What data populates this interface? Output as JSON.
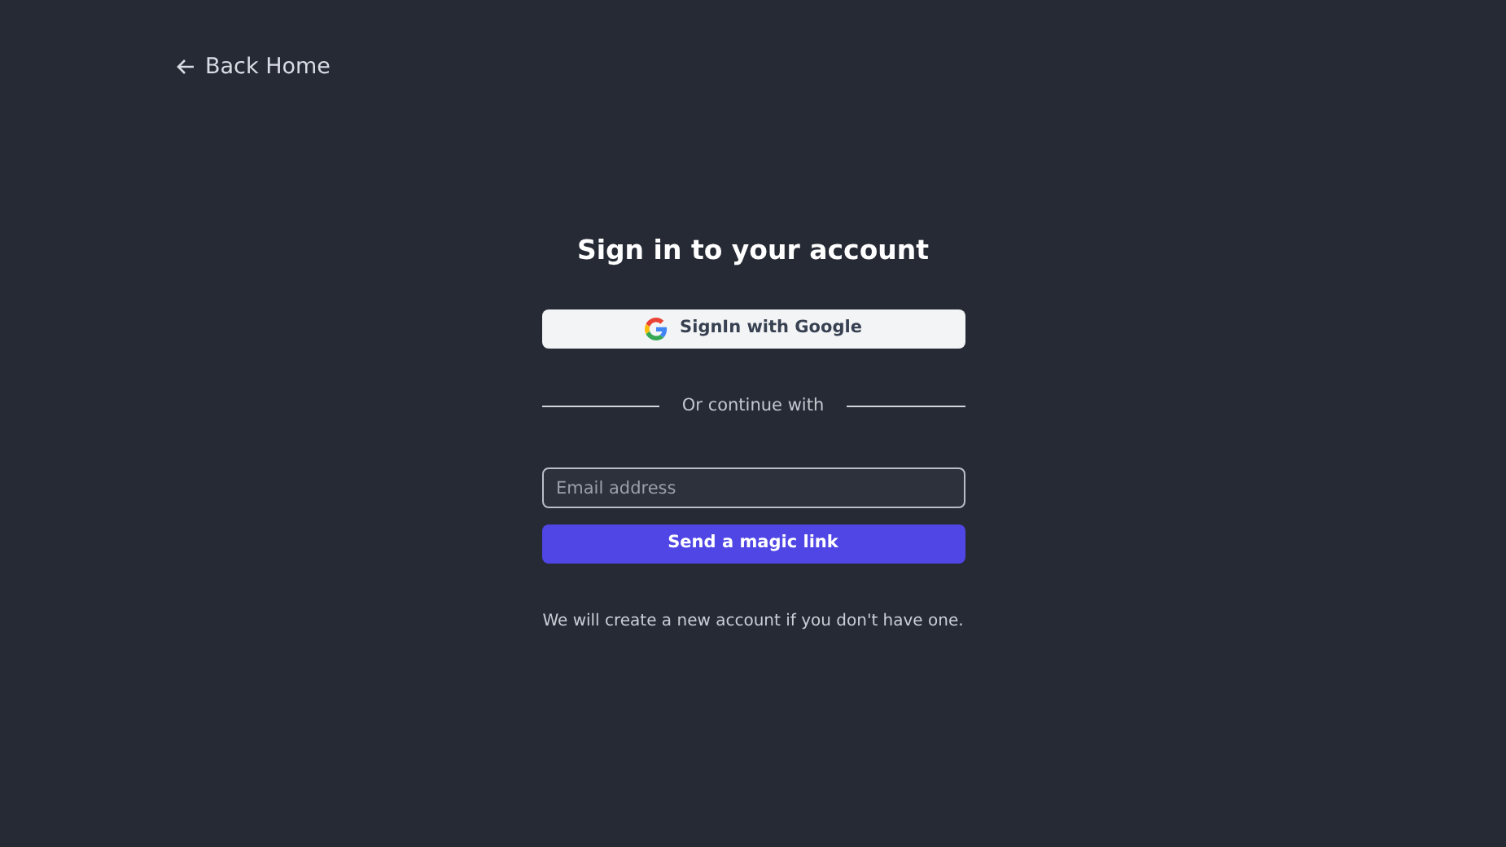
{
  "back_link": {
    "label": "Back Home"
  },
  "title": "Sign in to your account",
  "google_button": {
    "label": "SignIn with Google"
  },
  "divider": {
    "label": "Or continue with"
  },
  "email_field": {
    "placeholder": "Email address"
  },
  "submit_button": {
    "label": "Send a magic link"
  },
  "note": "We will create a new account if you don't have one."
}
